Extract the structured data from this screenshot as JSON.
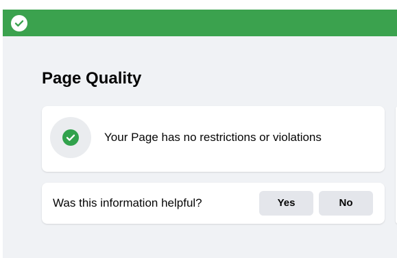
{
  "banner": {
    "icon": "checkmark-circle-icon",
    "color": "#3ba24e"
  },
  "page": {
    "title": "Page Quality"
  },
  "status": {
    "icon": "green-checkmark-icon",
    "icon_color": "#31a24c",
    "text": "Your Page has no restrictions or violations"
  },
  "feedback": {
    "question": "Was this information helpful?",
    "yes_label": "Yes",
    "no_label": "No"
  },
  "colors": {
    "background": "#f0f2f5",
    "card": "#ffffff",
    "button": "#e4e6eb",
    "text": "#050505"
  }
}
